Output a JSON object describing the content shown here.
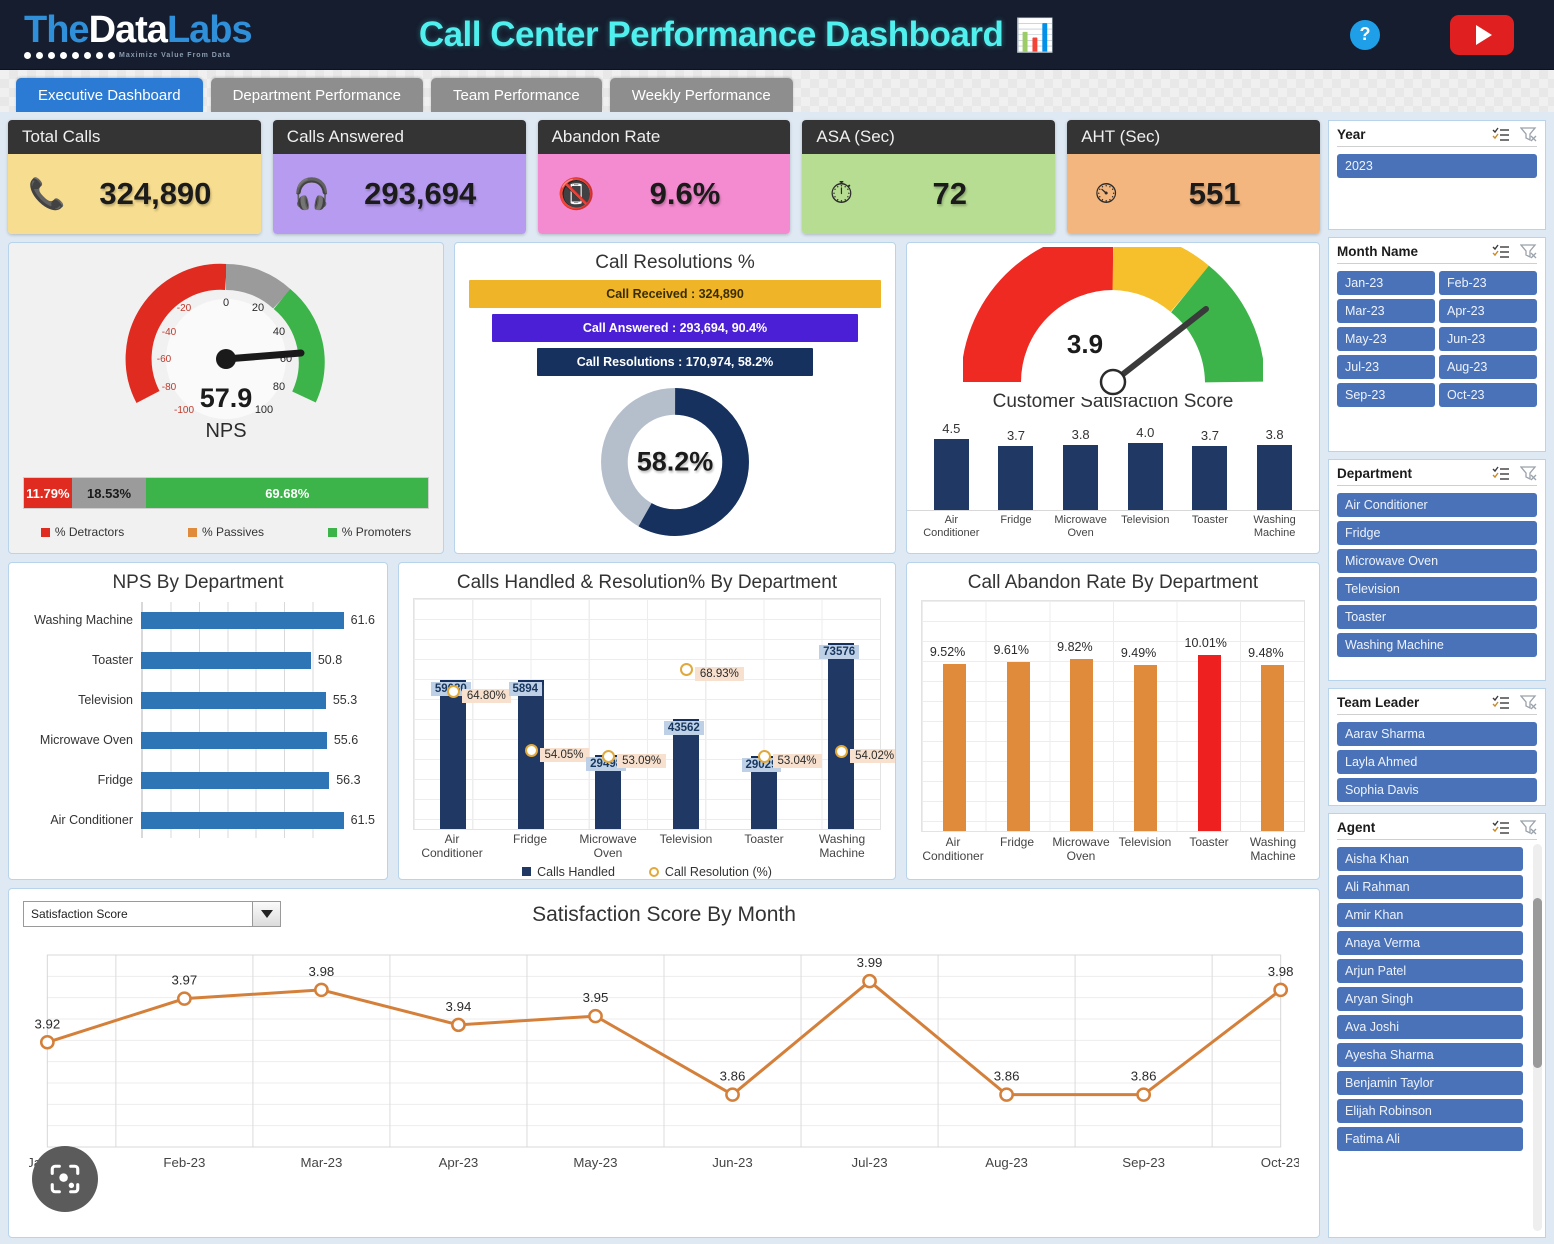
{
  "brand": {
    "name_the": "The",
    "name_data": "Data",
    "name_labs": "Labs",
    "tagline": "Maximize Value From Data"
  },
  "header": {
    "title": "Call Center Performance Dashboard",
    "title_emoji": "📊",
    "help_label": "?",
    "youtube_label": "▶"
  },
  "tabs": [
    {
      "label": "Executive Dashboard",
      "active": true
    },
    {
      "label": "Department Performance",
      "active": false
    },
    {
      "label": "Team Performance",
      "active": false
    },
    {
      "label": "Weekly Performance",
      "active": false
    }
  ],
  "kpis": [
    {
      "title": "Total Calls",
      "value": "324,890",
      "icon": "📞",
      "color": "#f7dd8f"
    },
    {
      "title": "Calls Answered",
      "value": "293,694",
      "icon": "🎧",
      "color": "#b79bf0"
    },
    {
      "title": "Abandon Rate",
      "value": "9.6%",
      "icon": "📵",
      "color": "#f48ad0"
    },
    {
      "title": "ASA (Sec)",
      "value": "72",
      "icon": "⏱",
      "color": "#b7dd92"
    },
    {
      "title": "AHT (Sec)",
      "value": "551",
      "icon": "⏲",
      "color": "#f3b67e"
    }
  ],
  "nps_gauge": {
    "value": "57.9",
    "label": "NPS",
    "ticks": [
      "-100",
      "-80",
      "-60",
      "-40",
      "-20",
      "0",
      "20",
      "40",
      "60",
      "80",
      "100"
    ],
    "segments": [
      {
        "label": "% Detractors",
        "value": "11.79%",
        "color": "#e02b20"
      },
      {
        "label": "% Passives",
        "value": "18.53%",
        "color": "#9b9b9b"
      },
      {
        "label": "% Promoters",
        "value": "69.68%",
        "color": "#3cb44a"
      }
    ],
    "legend_colors": [
      "#e02b20",
      "#e08a3c",
      "#3cb44a"
    ]
  },
  "call_resolutions": {
    "title": "Call Resolutions %",
    "funnel": [
      {
        "text": "Call Received : 324,890",
        "color": "#f0b429"
      },
      {
        "text": "Call Answered : 293,694, 90.4%",
        "color": "#4b1fd6"
      },
      {
        "text": "Call Resolutions : 170,974, 58.2%",
        "color": "#16315e"
      }
    ],
    "donut_center": "58.2%",
    "donut_pct": 58.2,
    "donut_fill": "#16315e",
    "donut_rest": "#b5bfcc"
  },
  "csat": {
    "title": "Customer Satisfaction Score",
    "gauge_value": "3.9",
    "gauge_pct": 78,
    "chart_data": {
      "type": "bar",
      "title": "Customer Satisfaction Score",
      "categories": [
        "Air Conditioner",
        "Fridge",
        "Microwave Oven",
        "Television",
        "Toaster",
        "Washing Machine"
      ],
      "values": [
        4.5,
        3.7,
        3.8,
        4.0,
        3.7,
        3.8
      ],
      "labels": [
        "4.5",
        "3.7",
        "3.8",
        "4.0",
        "3.7",
        "3.8"
      ],
      "ylim": [
        0,
        5
      ],
      "color": "#1f3864"
    }
  },
  "nps_by_dept": {
    "title": "NPS By Department",
    "chart_data": {
      "type": "bar",
      "orientation": "horizontal",
      "title": "NPS By Department",
      "categories": [
        "Washing Machine",
        "Toaster",
        "Television",
        "Microwave Oven",
        "Fridge",
        "Air Conditioner"
      ],
      "values": [
        61.6,
        50.8,
        55.3,
        55.6,
        56.3,
        61.5
      ],
      "labels": [
        "61.6",
        "50.8",
        "55.3",
        "55.6",
        "56.3",
        "61.5"
      ],
      "xlim": [
        0,
        70
      ],
      "color": "#2e75b6"
    }
  },
  "calls_handled": {
    "title": "Calls Handled & Resolution% By Department",
    "legend": [
      {
        "label": "Calls Handled",
        "color": "#1f3864",
        "marker": "square"
      },
      {
        "label": "Call Resolution (%)",
        "color": "#e0a93b",
        "marker": "circle"
      }
    ],
    "chart_data": {
      "type": "bar",
      "title": "Calls Handled & Resolution% By Department",
      "categories": [
        "Air Conditioner",
        "Fridge",
        "Microwave Oven",
        "Television",
        "Toaster",
        "Washing Machine"
      ],
      "series": [
        {
          "name": "Calls Handled",
          "values": [
            59080,
            58944,
            29498,
            43562,
            29029,
            73576
          ],
          "labels": [
            "59080",
            "5894",
            "29498",
            "43562",
            "29029",
            "73576"
          ]
        },
        {
          "name": "Call Resolution (%)",
          "values": [
            64.8,
            54.05,
            53.09,
            68.93,
            53.04,
            54.02
          ],
          "labels": [
            "64.80%",
            "54.05%",
            "53.09%",
            "68.93%",
            "53.04%",
            "54.02%"
          ]
        }
      ],
      "ylim": [
        0,
        80000
      ]
    }
  },
  "abandon_rate": {
    "title": "Call Abandon Rate By Department",
    "chart_data": {
      "type": "bar",
      "title": "Call Abandon Rate By Department",
      "categories": [
        "Air Conditioner",
        "Fridge",
        "Microwave Oven",
        "Television",
        "Toaster",
        "Washing Machine"
      ],
      "values": [
        9.52,
        9.61,
        9.82,
        9.49,
        10.01,
        9.48
      ],
      "labels": [
        "9.52%",
        "9.61%",
        "9.82%",
        "9.49%",
        "10.01%",
        "9.48%"
      ],
      "colors": [
        "#e08a3c",
        "#e08a3c",
        "#e08a3c",
        "#e08a3c",
        "#ee2020",
        "#e08a3c"
      ],
      "ylim": [
        0,
        11
      ]
    }
  },
  "satisfaction_by_month": {
    "title": "Satisfaction Score By Month",
    "selector_value": "Satisfaction Score",
    "chart_data": {
      "type": "line",
      "title": "Satisfaction Score By Month",
      "x": [
        "Jan-23",
        "Feb-23",
        "Mar-23",
        "Apr-23",
        "May-23",
        "Jun-23",
        "Jul-23",
        "Aug-23",
        "Sep-23",
        "Oct-23"
      ],
      "values": [
        3.92,
        3.97,
        3.98,
        3.94,
        3.95,
        3.86,
        3.99,
        3.86,
        3.86,
        3.98
      ],
      "labels": [
        "3.92",
        "3.97",
        "3.98",
        "3.94",
        "3.95",
        "3.86",
        "3.99",
        "3.86",
        "3.86",
        "3.98"
      ],
      "ylim": [
        3.8,
        4.02
      ],
      "color": "#d4803a",
      "grid": true
    }
  },
  "slicers": [
    {
      "name": "year",
      "title": "Year",
      "layout": "full",
      "items": [
        "2023"
      ]
    },
    {
      "name": "month",
      "title": "Month Name",
      "layout": "half",
      "items": [
        "Jan-23",
        "Feb-23",
        "Mar-23",
        "Apr-23",
        "May-23",
        "Jun-23",
        "Jul-23",
        "Aug-23",
        "Sep-23",
        "Oct-23"
      ]
    },
    {
      "name": "department",
      "title": "Department",
      "layout": "full",
      "items": [
        "Air Conditioner",
        "Fridge",
        "Microwave  Oven",
        "Television",
        "Toaster",
        "Washing Machine"
      ]
    },
    {
      "name": "team_leader",
      "title": "Team Leader",
      "layout": "full",
      "items": [
        "Aarav Sharma",
        "Layla Ahmed",
        "Sophia Davis"
      ]
    },
    {
      "name": "agent",
      "title": "Agent",
      "layout": "full",
      "items": [
        "Aisha Khan",
        "Ali Rahman",
        "Amir Khan",
        "Anaya Verma",
        "Arjun Patel",
        "Aryan Singh",
        "Ava Joshi",
        "Ayesha Sharma",
        "Benjamin Taylor",
        "Elijah Robinson",
        "Fatima Ali"
      ]
    }
  ],
  "overlay": {
    "lens_tooltip": "Search with lens"
  }
}
